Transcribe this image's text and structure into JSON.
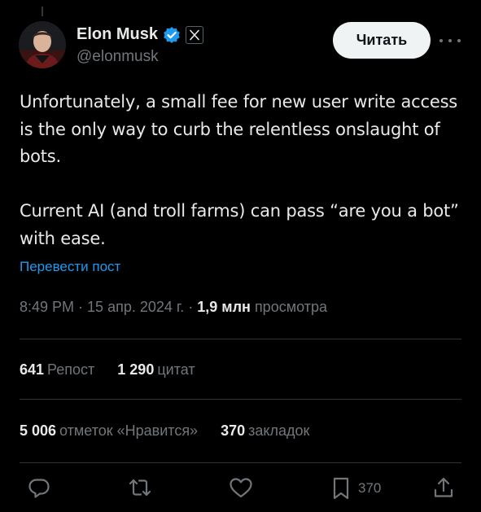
{
  "author": {
    "name": "Elon Musk",
    "handle": "@elonmusk",
    "verified": true,
    "affiliate_badge": "x-logo-icon"
  },
  "subscribe_label": "Читать",
  "tweet": {
    "paragraphs": [
      "Unfortunately, a small fee for new user write access is the only way to curb the relentless onslaught of bots.",
      "Current AI (and troll farms) can pass “are you a bot” with ease."
    ],
    "translate_label": "Перевести пост"
  },
  "meta": {
    "time": "8:49 PM",
    "separator": " · ",
    "date": "15 апр. 2024 г.",
    "views_count": "1,9 млн",
    "views_label": "просмотра"
  },
  "stats": {
    "reposts_count": "641",
    "reposts_label": "Репост",
    "quotes_count": "1 290",
    "quotes_label": "цитат",
    "likes_count": "5 006",
    "likes_label": "отметок «Нравится»",
    "bookmarks_count": "370",
    "bookmarks_label": "закладок"
  },
  "actions": {
    "bookmark_count": "370",
    "icons": [
      "reply-icon",
      "retweet-icon",
      "like-icon",
      "bookmark-icon",
      "share-icon"
    ]
  },
  "colors": {
    "background": "#000000",
    "text": "#e7e9ea",
    "muted": "#71767b",
    "link": "#1d9bf0",
    "verified": "#1d9bf0",
    "divider": "#2f3336",
    "button_bg": "#eff3f4"
  }
}
